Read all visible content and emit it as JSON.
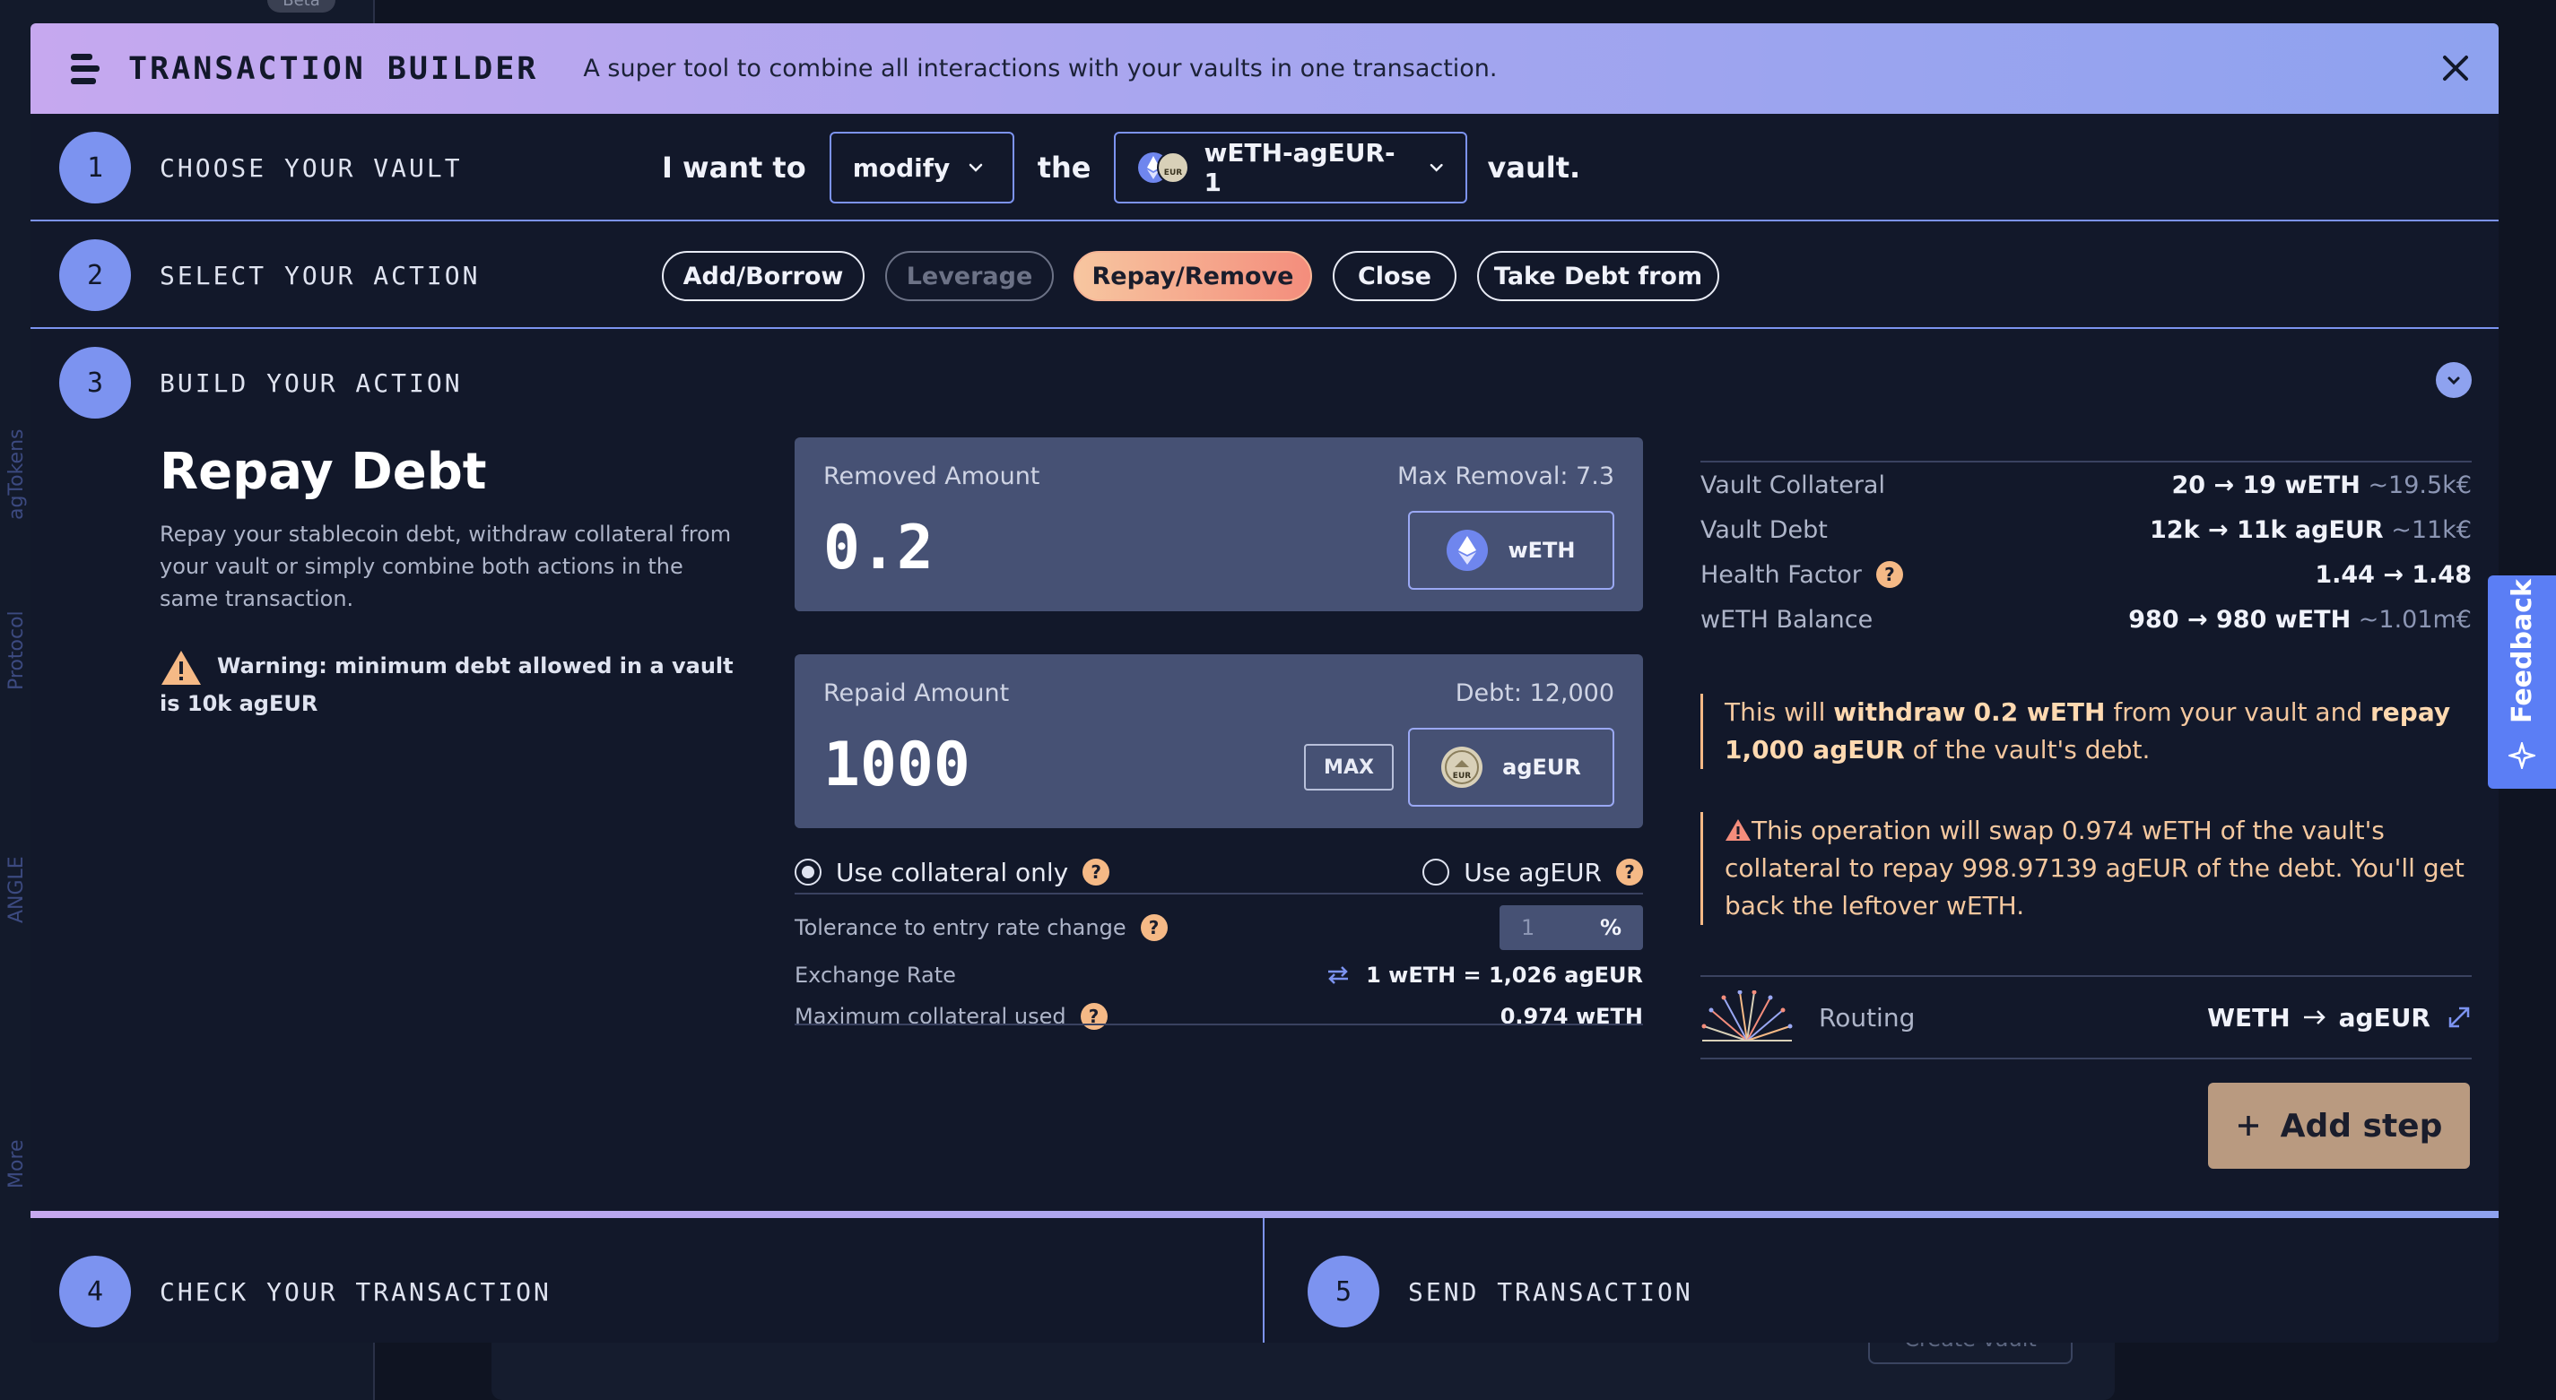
{
  "background": {
    "beta_badge": "Beta",
    "side_labels": [
      "agTokens",
      "Protocol",
      "ANGLE",
      "More"
    ],
    "create_vault_label": "Create vault"
  },
  "header": {
    "title": "TRANSACTION BUILDER",
    "subtitle": "A super tool to combine all interactions with your vaults in one transaction."
  },
  "steps": [
    {
      "number": "1",
      "label": "CHOOSE YOUR VAULT"
    },
    {
      "number": "2",
      "label": "SELECT YOUR ACTION"
    },
    {
      "number": "3",
      "label": "BUILD YOUR ACTION"
    },
    {
      "number": "4",
      "label": "CHECK YOUR TRANSACTION"
    },
    {
      "number": "5",
      "label": "SEND TRANSACTION"
    }
  ],
  "vault_sentence": {
    "prefix": "I want to",
    "action": "modify",
    "middle": "the",
    "vault": "wETH-agEUR-1",
    "suffix": "vault."
  },
  "actions": [
    {
      "label": "Add/Borrow",
      "state": "normal"
    },
    {
      "label": "Leverage",
      "state": "disabled"
    },
    {
      "label": "Repay/Remove",
      "state": "active"
    },
    {
      "label": "Close",
      "state": "normal"
    },
    {
      "label": "Take Debt from",
      "state": "normal"
    }
  ],
  "build": {
    "title": "Repay Debt",
    "description": "Repay your stablecoin debt, withdraw collateral from your vault or simply combine both actions in the same transaction.",
    "warning": "Warning: minimum debt allowed in a vault is 10k agEUR"
  },
  "removed": {
    "label": "Removed Amount",
    "max_label": "Max Removal: 7.3",
    "value": "0.2",
    "token": "wETH"
  },
  "repaid": {
    "label": "Repaid Amount",
    "debt_label": "Debt: 12,000",
    "value": "1000",
    "max_button": "MAX",
    "token": "agEUR"
  },
  "options": {
    "collateral_only": "Use collateral only",
    "use_ageur": "Use agEUR",
    "selected": "collateral_only"
  },
  "details": {
    "tolerance_label": "Tolerance to entry rate change",
    "tolerance_value": "1",
    "tolerance_unit": "%",
    "rate_label": "Exchange Rate",
    "rate_value": "1 wETH = 1,026 agEUR",
    "max_collateral_label": "Maximum collateral used",
    "max_collateral_value": "0.974 wETH"
  },
  "stats": [
    {
      "label": "Vault Collateral",
      "value": "20 → 19 wETH",
      "sub": "~19.5k€",
      "help": false
    },
    {
      "label": "Vault Debt",
      "value": "12k → 11k agEUR",
      "sub": "~11k€",
      "help": false
    },
    {
      "label": "Health Factor",
      "value": "1.44 → 1.48",
      "sub": "",
      "help": true
    },
    {
      "label": "wETH Balance",
      "value": "980 → 980 wETH",
      "sub": "~1.01m€",
      "help": false
    }
  ],
  "notice1": {
    "t1": "This will ",
    "b1": "withdraw",
    "t2": " ",
    "b2": "0.2 wETH",
    "t3": " from your vault and ",
    "b3": "repay",
    "t4": " ",
    "b4": "1,000 agEUR",
    "t5": " of the vault's debt."
  },
  "notice2": "This operation will swap 0.974 wETH of the vault's collateral to repay 998.97139 agEUR of the debt. You'll get back the leftover wETH.",
  "routing": {
    "label": "Routing",
    "from": "WETH",
    "to": "agEUR"
  },
  "add_step": "Add step",
  "colors": {
    "accent": "#7c93f0",
    "warning": "#f5b986",
    "active_pill_start": "#f7c6a0",
    "active_pill_end": "#f48d7c",
    "add_step": "#b99a80"
  }
}
